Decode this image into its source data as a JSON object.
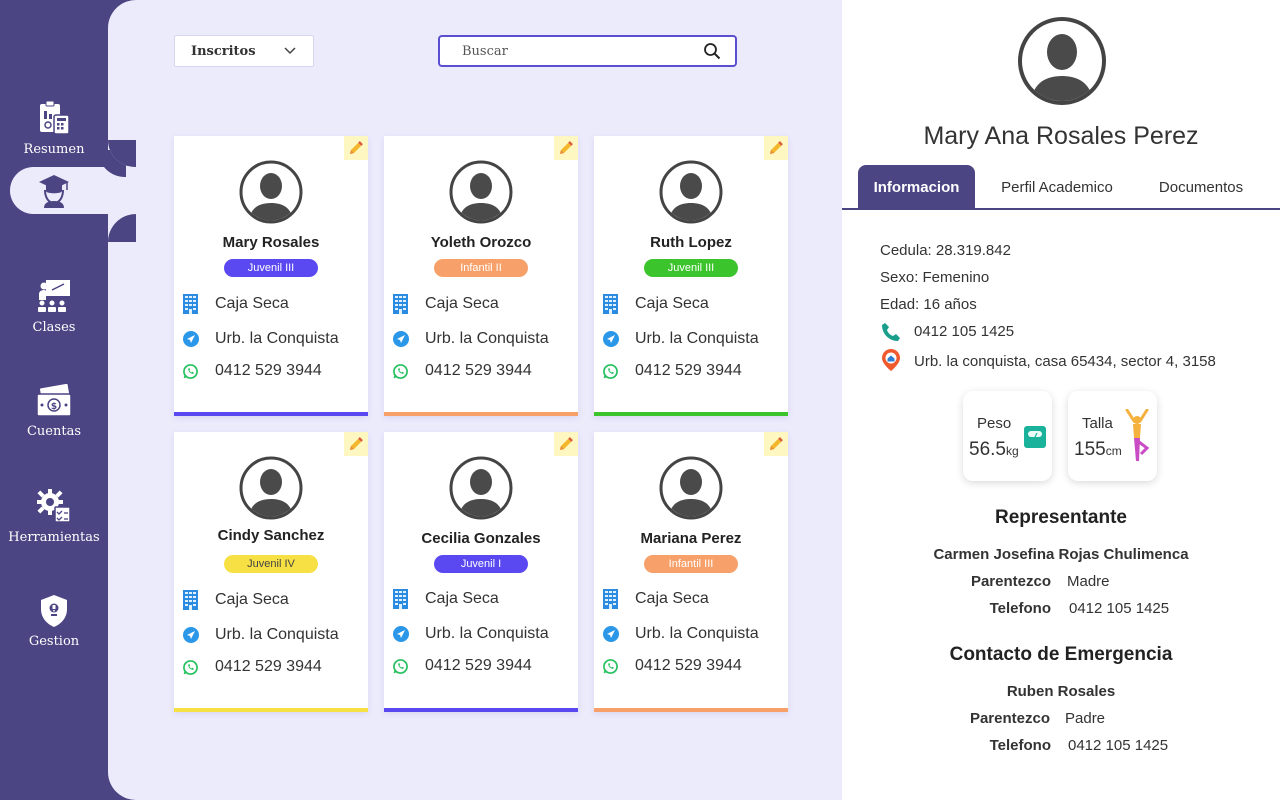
{
  "sidebar": {
    "items": [
      {
        "label": "Resumen",
        "icon": "clipboard-calculator-icon"
      },
      {
        "label": "",
        "icon": "graduate-icon"
      },
      {
        "label": "Clases",
        "icon": "classroom-teacher-icon"
      },
      {
        "label": "Cuentas",
        "icon": "cash-money-icon"
      },
      {
        "label": "Herramientas",
        "icon": "gear-checklist-icon"
      },
      {
        "label": "Gestion",
        "icon": "shield-alert-icon"
      }
    ]
  },
  "filter": {
    "selected": "Inscritos"
  },
  "search": {
    "placeholder": "Buscar"
  },
  "cards": [
    {
      "name": "Mary Rosales",
      "level": "Juvenil III",
      "color": "#5a48f0",
      "city": "Caja Seca",
      "address": "Urb. la Conquista",
      "phone": "0412 529 3944"
    },
    {
      "name": "Yoleth Orozco",
      "level": "Infantil II",
      "color": "#f7a06a",
      "city": "Caja Seca",
      "address": "Urb. la Conquista",
      "phone": "0412 529 3944"
    },
    {
      "name": "Ruth Lopez",
      "level": "Juvenil III",
      "color": "#3bc42c",
      "city": "Caja Seca",
      "address": "Urb. la Conquista",
      "phone": "0412 529 3944"
    },
    {
      "name": "Cindy Sanchez",
      "level": "Juvenil IV",
      "color": "#f7e043",
      "city": "Caja Seca",
      "address": "Urb. la Conquista",
      "phone": "0412 529 3944"
    },
    {
      "name": "Cecilia Gonzales",
      "level": "Juvenil I",
      "color": "#5a48f0",
      "city": "Caja Seca",
      "address": "Urb. la Conquista",
      "phone": "0412 529 3944"
    },
    {
      "name": "Mariana Perez",
      "level": "Infantil III",
      "color": "#f7a06a",
      "city": "Caja Seca",
      "address": "Urb. la Conquista",
      "phone": "0412 529 3944"
    }
  ],
  "profile": {
    "name": "Mary Ana Rosales Perez",
    "tabs": [
      "Informacion",
      "Perfil Academico",
      "Documentos"
    ],
    "cedula": "Cedula: 28.319.842",
    "sexo": "Sexo: Femenino",
    "edad": "Edad: 16 años",
    "phone": "0412 105 1425",
    "address": "Urb. la conquista, casa 65434, sector 4, 3158",
    "peso": {
      "label": "Peso",
      "value": "56.5",
      "unit": "kg"
    },
    "talla": {
      "label": "Talla",
      "value": "155",
      "unit": "cm"
    },
    "representante": {
      "title": "Representante",
      "name": "Carmen Josefina Rojas Chulimenca",
      "parentezco_label": "Parentezco",
      "parentezco": "Madre",
      "telefono_label": "Telefono",
      "telefono": "0412 105 1425"
    },
    "emergencia": {
      "title": "Contacto de Emergencia",
      "name": "Ruben Rosales",
      "parentezco_label": "Parentezco",
      "parentezco": "Padre",
      "telefono_label": "Telefono",
      "telefono": "0412 105 1425"
    }
  }
}
